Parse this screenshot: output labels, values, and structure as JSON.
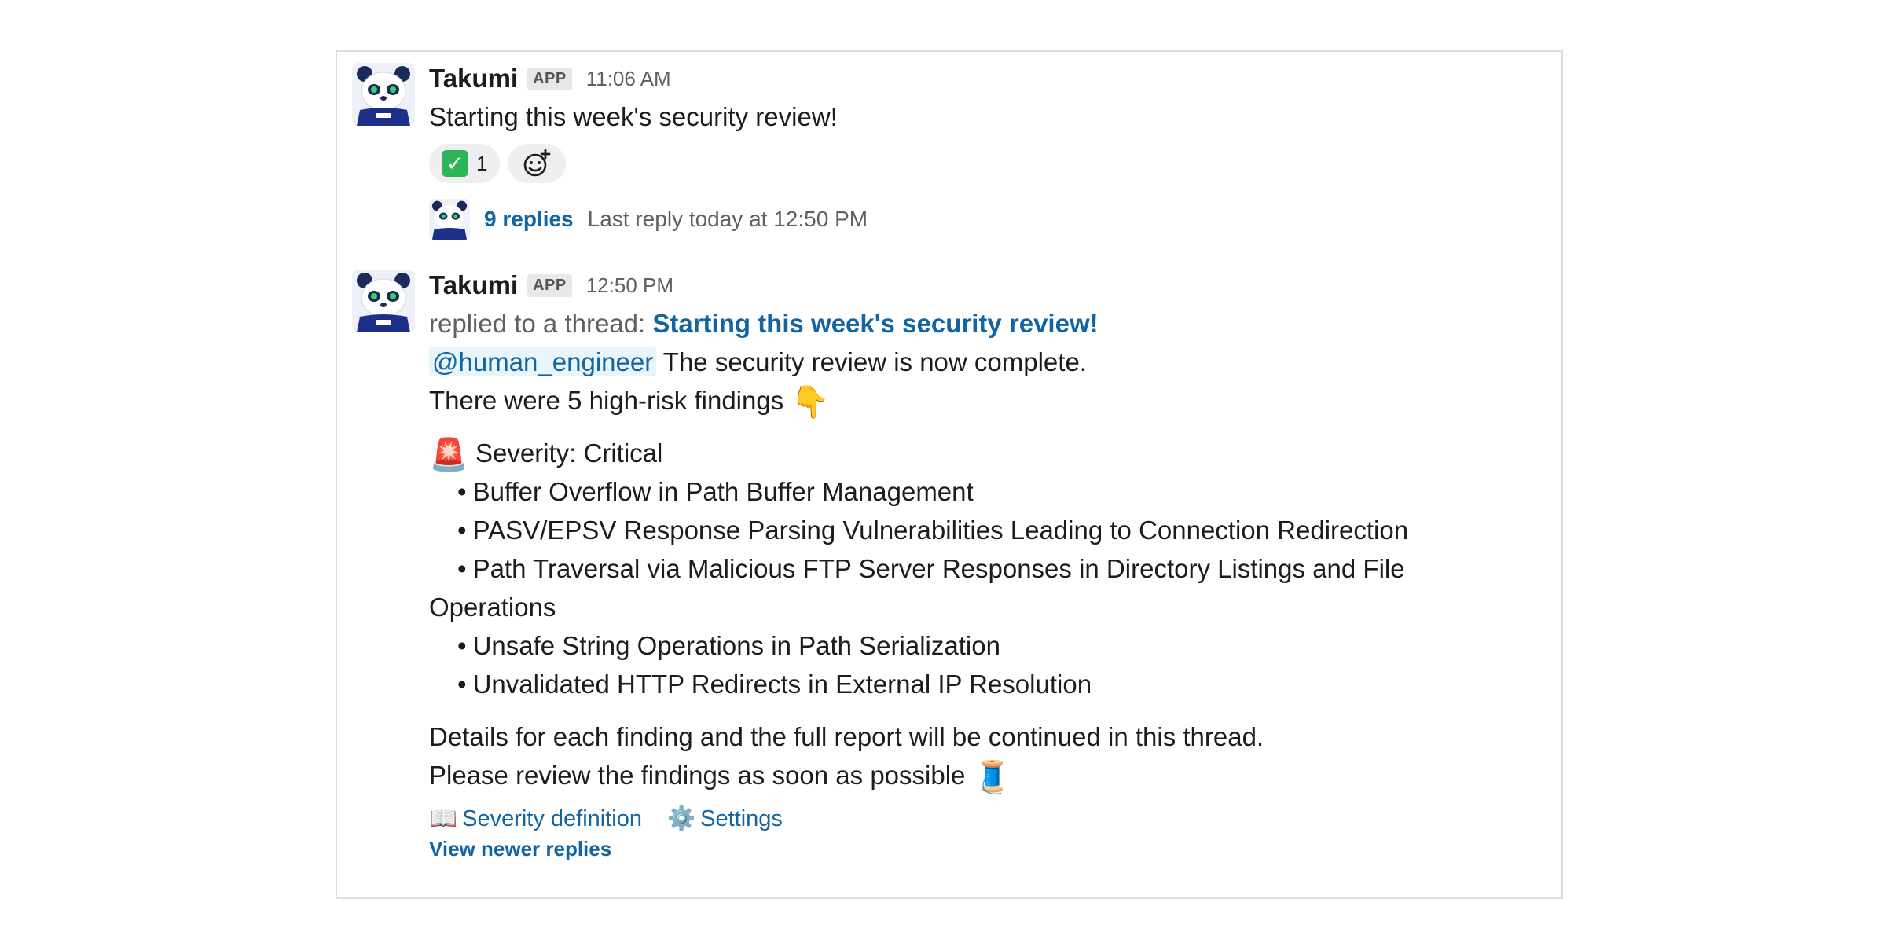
{
  "messages": [
    {
      "author": "Takumi",
      "badge": "APP",
      "time": "11:06 AM",
      "text": "Starting this week's security review!",
      "reactions": [
        {
          "emoji": "✅",
          "count": "1"
        }
      ],
      "thread": {
        "replies": "9 replies",
        "last_reply": "Last reply today at 12:50 PM"
      }
    },
    {
      "author": "Takumi",
      "badge": "APP",
      "time": "12:50 PM",
      "replied_prefix": "replied to a thread:",
      "replied_link": "Starting this week's security review!",
      "mention": "@human_engineer",
      "line1_rest": "The security review is now complete.",
      "line2": "There were 5 high-risk findings",
      "line2_emoji": "👇",
      "severity_emoji": "🚨",
      "severity": "Severity: Critical",
      "findings": [
        "Buffer Overflow in Path Buffer Management",
        "PASV/EPSV Response Parsing Vulnerabilities Leading to Connection Redirection",
        "Path Traversal via Malicious FTP Server Responses in Directory Listings and File",
        "Unsafe String Operations in Path Serialization",
        "Unvalidated HTTP Redirects in External IP Resolution"
      ],
      "finding_wrap": "Operations",
      "details": "Details for each finding and the full report will be continued in this thread.",
      "please_review": "Please review the findings as soon as possible",
      "please_emoji": "🧵",
      "footer_links": [
        {
          "icon": "📖",
          "label": "Severity definition"
        },
        {
          "icon": "⚙️",
          "label": "Settings"
        }
      ],
      "view_newer": "View newer replies"
    }
  ],
  "colors": {
    "link": "#1264a3",
    "muted": "#616061",
    "text": "#1d1c1d",
    "mention_bg": "#e8f5fa",
    "border": "#dddddd"
  }
}
